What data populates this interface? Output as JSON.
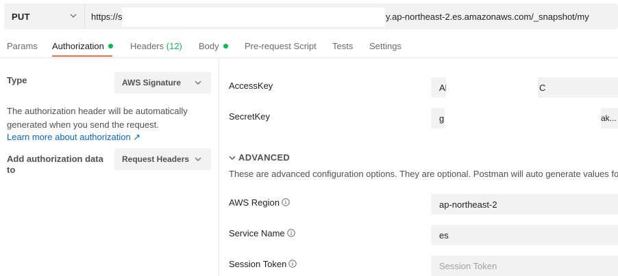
{
  "request": {
    "method": "PUT",
    "url_start": "https://s",
    "url_end": "y.ap-northeast-2.es.amazonaws.com/_snapshot/my"
  },
  "tabs": [
    {
      "label": "Params"
    },
    {
      "label": "Authorization",
      "active": true,
      "dot": true
    },
    {
      "label": "Headers",
      "count": "(12)"
    },
    {
      "label": "Body",
      "dot": true
    },
    {
      "label": "Pre-request Script"
    },
    {
      "label": "Tests"
    },
    {
      "label": "Settings"
    }
  ],
  "left": {
    "type_label": "Type",
    "type_value": "AWS Signature",
    "description": "The authorization header will be automatically generated when you send the request.",
    "learn_more": "Learn more about authorization ↗",
    "add_to_label": "Add authorization data to",
    "add_to_value": "Request Headers"
  },
  "right": {
    "access_key": {
      "label": "AccessKey",
      "value_start": "Al",
      "value_end": "C"
    },
    "secret_key": {
      "label": "SecretKey",
      "value_start": "g",
      "value_end": "ak..."
    },
    "advanced": {
      "title": "ADVANCED",
      "description": "These are advanced configuration options. They are optional. Postman will auto generate values for s"
    },
    "aws_region": {
      "label": "AWS Region",
      "value": "ap-northeast-2"
    },
    "service_name": {
      "label": "Service Name",
      "value": "es"
    },
    "session_token": {
      "label": "Session Token",
      "placeholder": "Session Token"
    }
  },
  "colors": {
    "accent": "#ff6c37",
    "status_dot": "#0cbb52",
    "link": "#0265d2"
  }
}
